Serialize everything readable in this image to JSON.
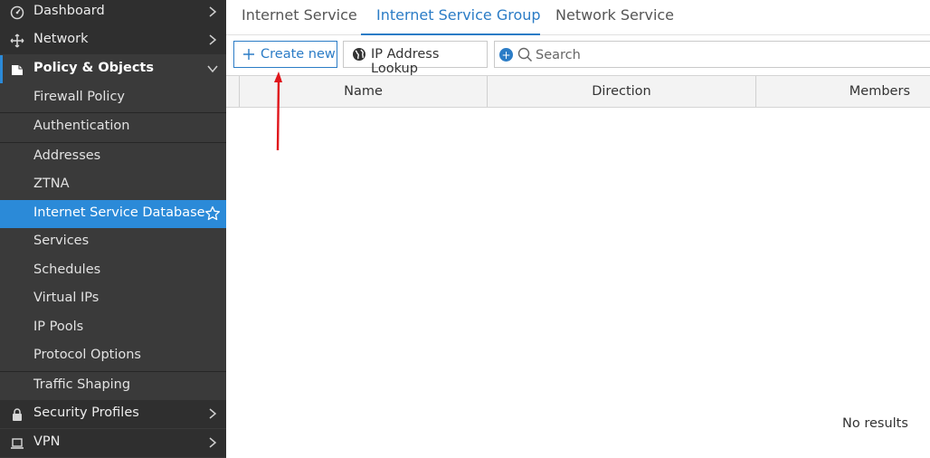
{
  "sidebar": {
    "items": [
      {
        "label": "Dashboard",
        "icon": "dashboard-icon"
      },
      {
        "label": "Network",
        "icon": "network-icon"
      },
      {
        "label": "Policy & Objects",
        "icon": "policy-objects-icon"
      },
      {
        "label": "Security Profiles",
        "icon": "lock-icon"
      },
      {
        "label": "VPN",
        "icon": "laptop-icon"
      }
    ],
    "sub_items": [
      {
        "label": "Firewall Policy"
      },
      {
        "label": "Authentication"
      },
      {
        "label": "Addresses"
      },
      {
        "label": "ZTNA"
      },
      {
        "label": "Internet Service Database"
      },
      {
        "label": "Services"
      },
      {
        "label": "Schedules"
      },
      {
        "label": "Virtual IPs"
      },
      {
        "label": "IP Pools"
      },
      {
        "label": "Protocol Options"
      },
      {
        "label": "Traffic Shaping"
      }
    ]
  },
  "tabs": [
    {
      "label": "Internet Service"
    },
    {
      "label": "Internet Service Group"
    },
    {
      "label": "Network Service"
    }
  ],
  "toolbar": {
    "create_label": "Create new",
    "lookup_label": "IP Address Lookup",
    "search_placeholder": "Search"
  },
  "table": {
    "columns": [
      "Name",
      "Direction",
      "Members"
    ],
    "empty_text": "No results"
  },
  "colors": {
    "accent": "#2b7cc6",
    "sidebar_bg": "#3a3a3a",
    "active_item": "#2b8ad8",
    "annotation": "#e0151b"
  }
}
